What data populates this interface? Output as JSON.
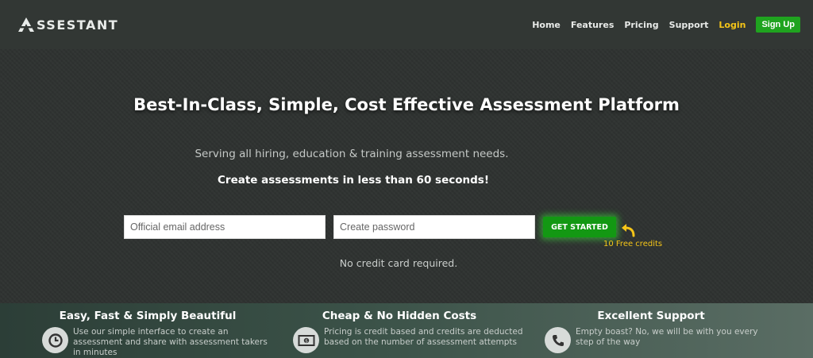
{
  "brand": {
    "name": "SSESTANT"
  },
  "nav": {
    "items": [
      {
        "label": "Home"
      },
      {
        "label": "Features"
      },
      {
        "label": "Pricing"
      },
      {
        "label": "Support"
      }
    ],
    "login": "Login",
    "signup": "Sign Up"
  },
  "hero": {
    "headline": "Best-In-Class, Simple, Cost Effective Assessment Platform",
    "sub1": "Serving all hiring, education & training assessment needs.",
    "sub2": "Create assessments in less than 60 seconds!",
    "email_placeholder": "Official email address",
    "password_placeholder": "Create password",
    "cta": "GET STARTED",
    "free_credits": "10 Free credits",
    "no_card": "No credit card required."
  },
  "features": [
    {
      "title": "Easy, Fast & Simply Beautiful",
      "text": "Use our simple interface to create an assessment and share with assessment takers in minutes",
      "icon": "clock-icon"
    },
    {
      "title": "Cheap & No Hidden Costs",
      "text": "Pricing is credit based and credits are deducted based on the number of assessment attempts",
      "icon": "money-icon"
    },
    {
      "title": "Excellent Support",
      "text": "Empty boast? No, we will be with you every step of the way",
      "icon": "phone-icon"
    }
  ],
  "colors": {
    "accent_green": "#1fa31f",
    "login_yellow": "#f5c518",
    "background": "#2f3331"
  }
}
